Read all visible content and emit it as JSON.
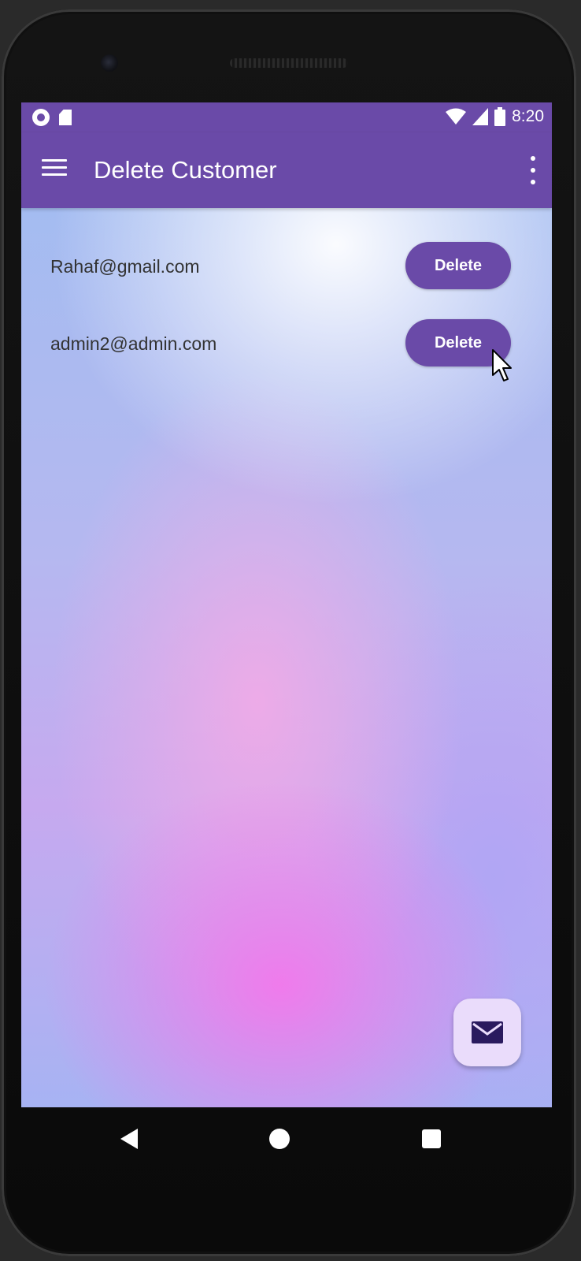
{
  "status_bar": {
    "time": "8:20",
    "left_icons": [
      "circle-notification-icon",
      "sd-card-icon"
    ],
    "right_icons": [
      "wifi-icon",
      "cell-signal-icon",
      "battery-icon"
    ]
  },
  "app_bar": {
    "title": "Delete Customer",
    "menu_icon": "hamburger-menu-icon",
    "overflow_icon": "more-vert-icon"
  },
  "customers": [
    {
      "email": "Rahaf@gmail.com",
      "button_label": "Delete"
    },
    {
      "email": "admin2@admin.com",
      "button_label": "Delete"
    }
  ],
  "fab": {
    "icon": "mail-icon"
  },
  "nav_bar": {
    "icons": [
      "back-icon",
      "home-icon",
      "recents-icon"
    ]
  },
  "colors": {
    "primary": "#6a4aa8",
    "fab_background": "#eadcfb",
    "fab_icon": "#2a1a5e",
    "text": "#333333"
  }
}
